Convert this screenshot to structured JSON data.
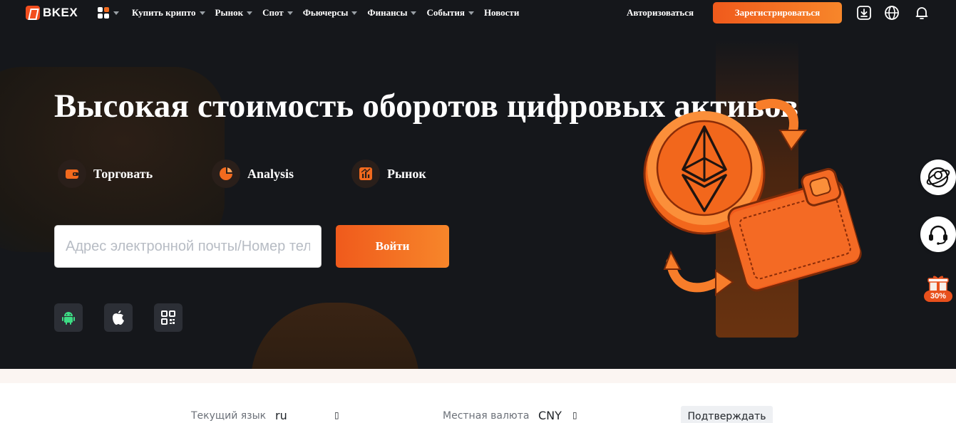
{
  "brand": {
    "name": "BKEX"
  },
  "nav": {
    "menu": [
      {
        "label": "Купить крипто",
        "has_dropdown": true
      },
      {
        "label": "Рынок",
        "has_dropdown": true
      },
      {
        "label": "Спот",
        "has_dropdown": true
      },
      {
        "label": "Фьючерсы",
        "has_dropdown": true
      },
      {
        "label": "Финансы",
        "has_dropdown": true
      },
      {
        "label": "События",
        "has_dropdown": true
      },
      {
        "label": "Новости",
        "has_dropdown": false
      }
    ],
    "login": "Авторизоваться",
    "register": "Зарегистрироваться",
    "icons": [
      "download-icon",
      "globe-icon",
      "bell-icon"
    ]
  },
  "hero": {
    "headline": "Высокая стоимость оборотов цифровых активов",
    "features": [
      {
        "label": "Торговать",
        "icon": "wallet-icon"
      },
      {
        "label": "Analysis",
        "icon": "pie-chart-icon"
      },
      {
        "label": "Рынок",
        "icon": "bar-chart-icon"
      }
    ],
    "email_placeholder": "Адрес электронной почты/Номер телефона",
    "signin": "Войти",
    "apps": [
      "android-icon",
      "apple-icon",
      "qr-code-icon"
    ]
  },
  "side": {
    "gift_badge": "30%"
  },
  "language_bar": {
    "language_label": "Текущий язык",
    "language_value": "ru",
    "currency_label": "Местная валюта",
    "currency_value": "CNY",
    "dropdown_glyph": "▯",
    "confirm": "Подтверждать"
  },
  "colors": {
    "accent": "#f26a1e",
    "background": "#15171b"
  }
}
